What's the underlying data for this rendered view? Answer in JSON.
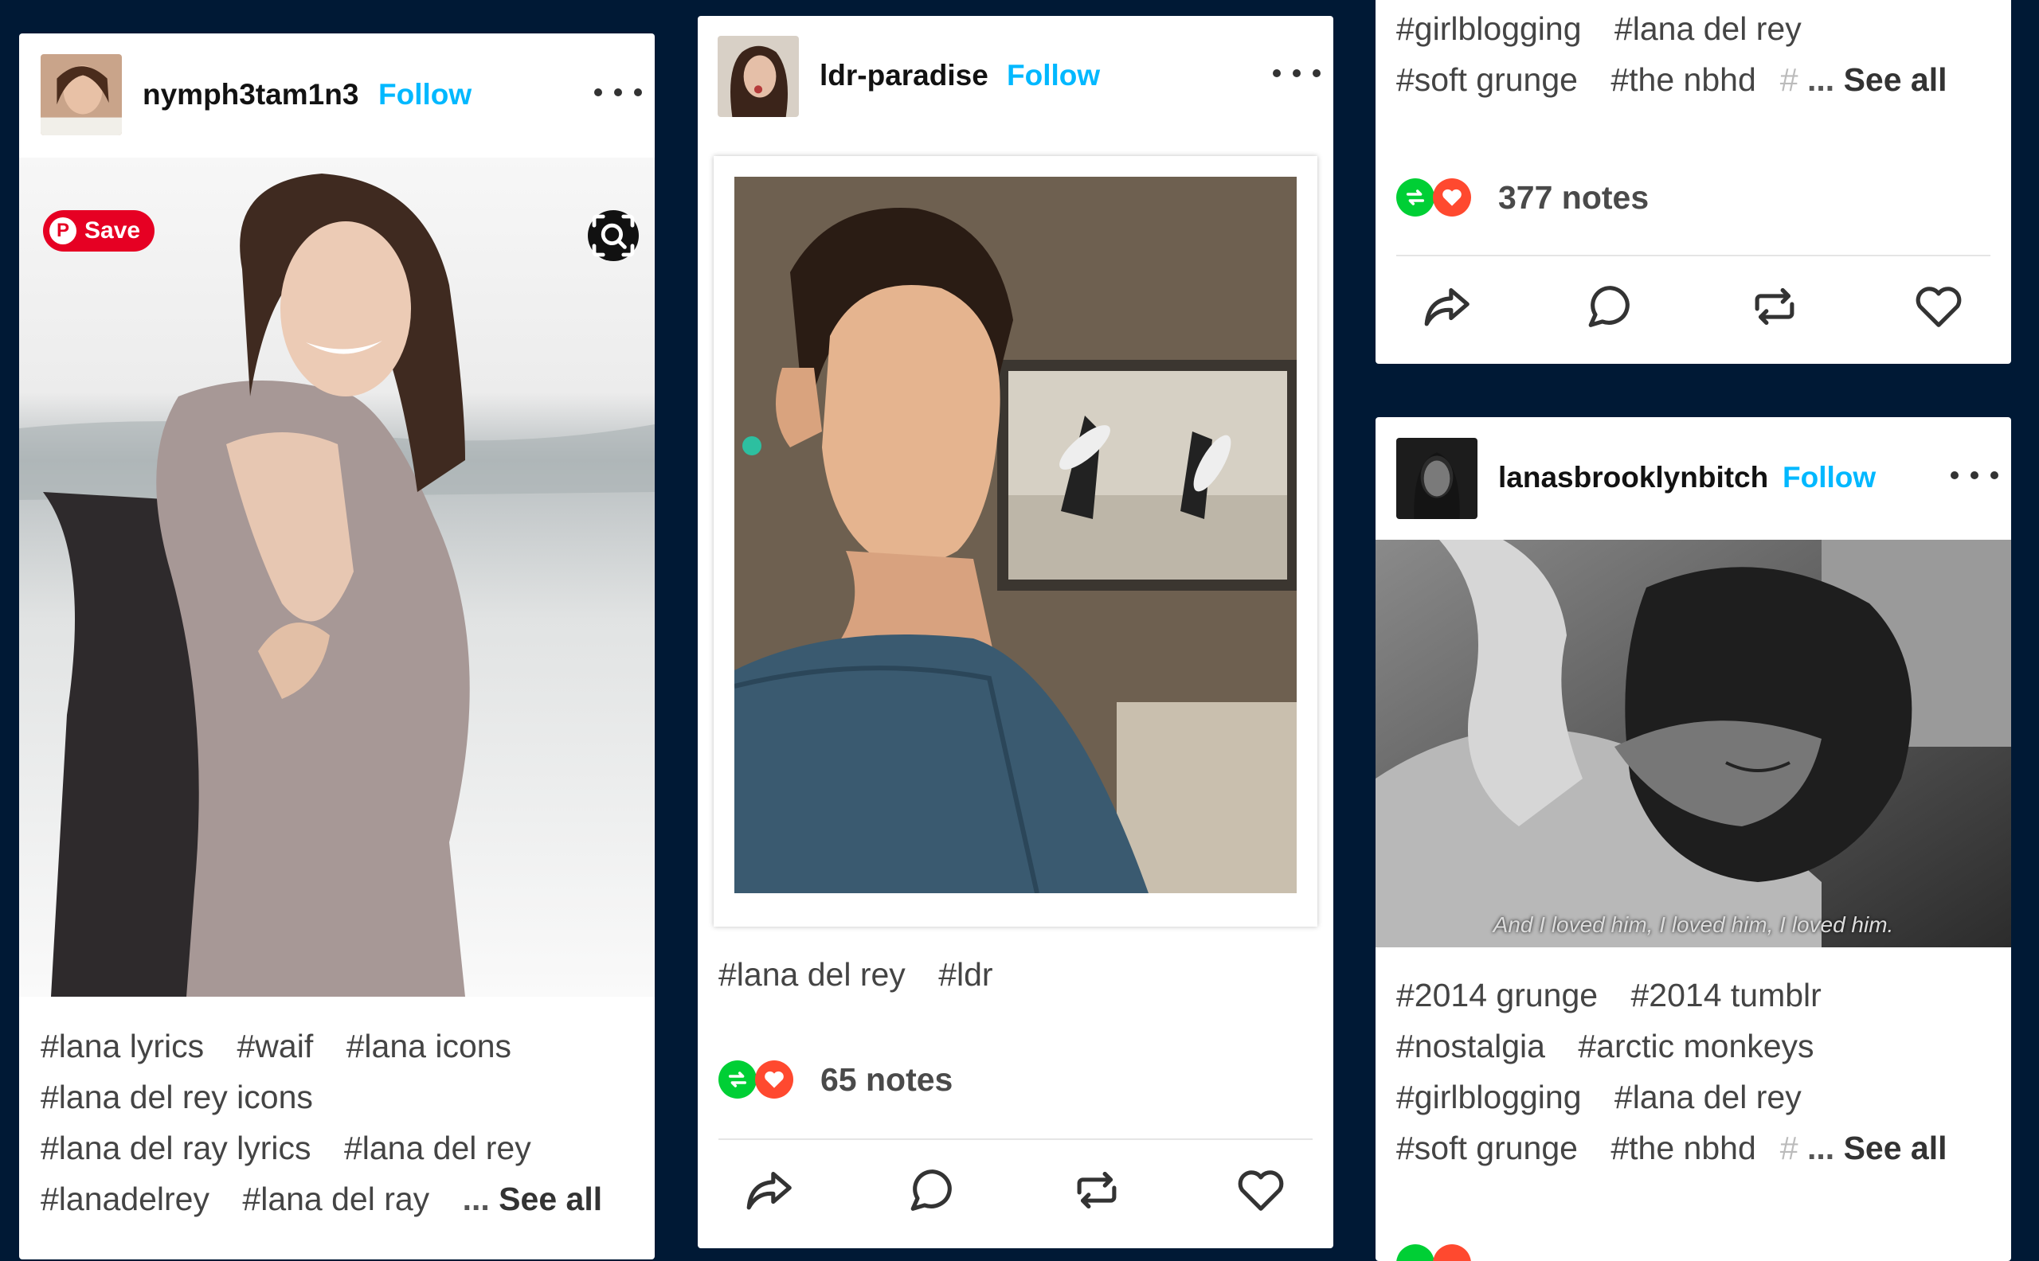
{
  "posts": [
    {
      "username": "nymph3tam1n3",
      "follow_label": "Follow",
      "save_label": "Save",
      "tags": [
        "#lana lyrics",
        "#waif",
        "#lana icons",
        "#lana del rey icons",
        "#lana del ray lyrics",
        "#lana del rey",
        "#lanadelrey",
        "#lana del ray"
      ],
      "see_all_label": "See all"
    },
    {
      "username": "ldr-paradise",
      "follow_label": "Follow",
      "tags": [
        "#lana del rey",
        "#ldr"
      ],
      "notes": "65 notes"
    },
    {
      "tags": [
        "#girlblogging",
        "#lana del rey",
        "#soft grunge",
        "#the nbhd"
      ],
      "see_all_label": "See all",
      "notes": "377 notes"
    },
    {
      "username": "lanasbrooklynbitch",
      "follow_label": "Follow",
      "caption": "And I loved him, I loved him, I loved him.",
      "tags": [
        "#2014 grunge",
        "#2014 tumblr",
        "#nostalgia",
        "#arctic monkeys",
        "#girlblogging",
        "#lana del rey",
        "#soft grunge",
        "#the nbhd"
      ],
      "see_all_label": "See all"
    }
  ],
  "colors": {
    "background": "#001935",
    "follow": "#00b8ff",
    "reblog_badge": "#00cf35",
    "like_badge": "#ff492f",
    "save": "#e60023"
  },
  "icons": [
    "share-icon",
    "reply-icon",
    "reblog-icon",
    "like-icon",
    "more-icon",
    "visual-search-icon",
    "pinterest-icon"
  ]
}
